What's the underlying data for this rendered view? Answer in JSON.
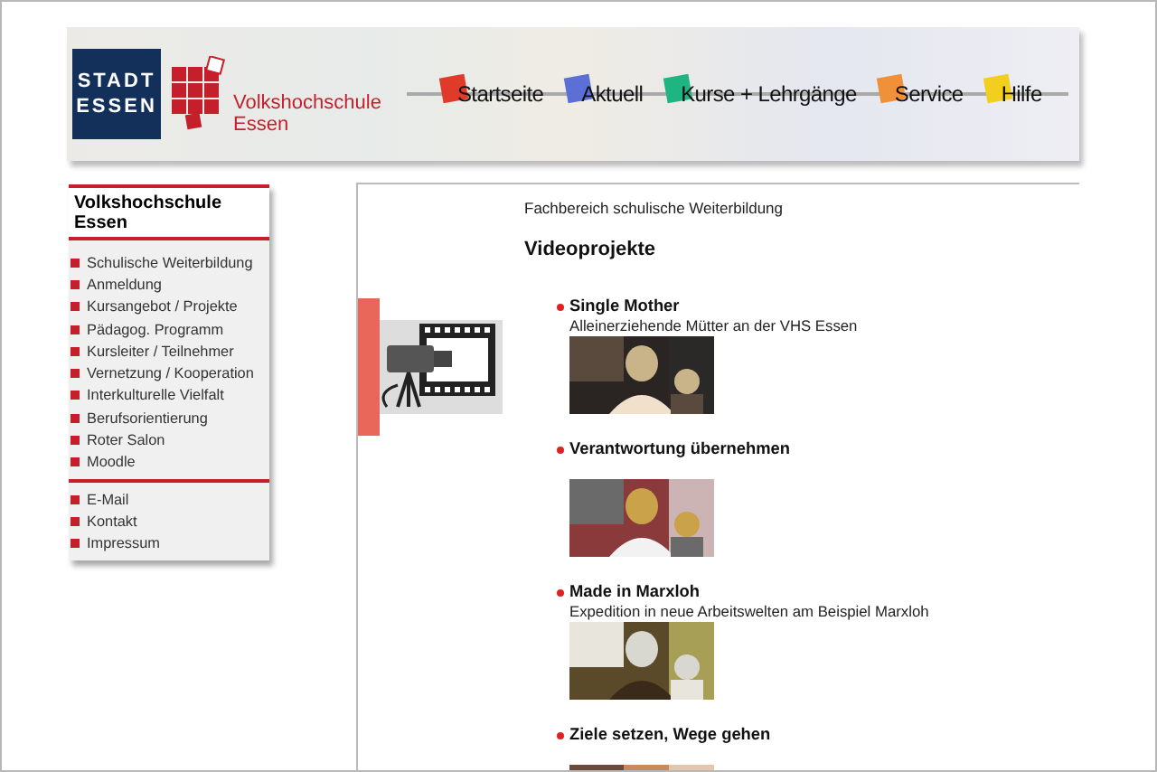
{
  "header": {
    "city_logo": [
      "STADT",
      "ESSEN"
    ],
    "school_name": [
      "Volkshochschule",
      "Essen"
    ],
    "nav": [
      {
        "label": "Startseite",
        "color": "#e03a2a"
      },
      {
        "label": "Aktuell",
        "color": "#5b6fd6"
      },
      {
        "label": "Kurse + Lehrgänge",
        "color": "#1fb583"
      },
      {
        "label": "Service",
        "color": "#f0913a"
      },
      {
        "label": "Hilfe",
        "color": "#f2cf1e"
      }
    ]
  },
  "sidebar": {
    "title": "Volkshochschule Essen",
    "groups": [
      [
        "Schulische Weiterbildung",
        "Anmeldung",
        "Kursangebot / Projekte",
        "Pädagog. Programm",
        "Kursleiter / Teilnehmer",
        "Vernetzung / Kooperation",
        "Interkulturelle Vielfalt",
        "Berufsorientierung",
        "Roter Salon",
        "Moodle"
      ],
      [
        "E-Mail",
        "Kontakt",
        "Impressum"
      ]
    ]
  },
  "content": {
    "breadcrumb": "Fachbereich schulische Weiterbildung",
    "heading": "Videoprojekte",
    "videos": [
      {
        "title": "Single Mother",
        "subtitle": "Alleinerziehende Mütter an der VHS Essen",
        "kind": "picture"
      },
      {
        "title": "Verantwortung übernehmen",
        "kind": "picture"
      },
      {
        "title": "Made in Marxloh",
        "subtitle": "Expedition in neue Arbeitswelten am Beispiel Marxloh",
        "kind": "picture"
      },
      {
        "title": "Ziele setzen, Wege gehen",
        "kind": "picture"
      }
    ]
  }
}
